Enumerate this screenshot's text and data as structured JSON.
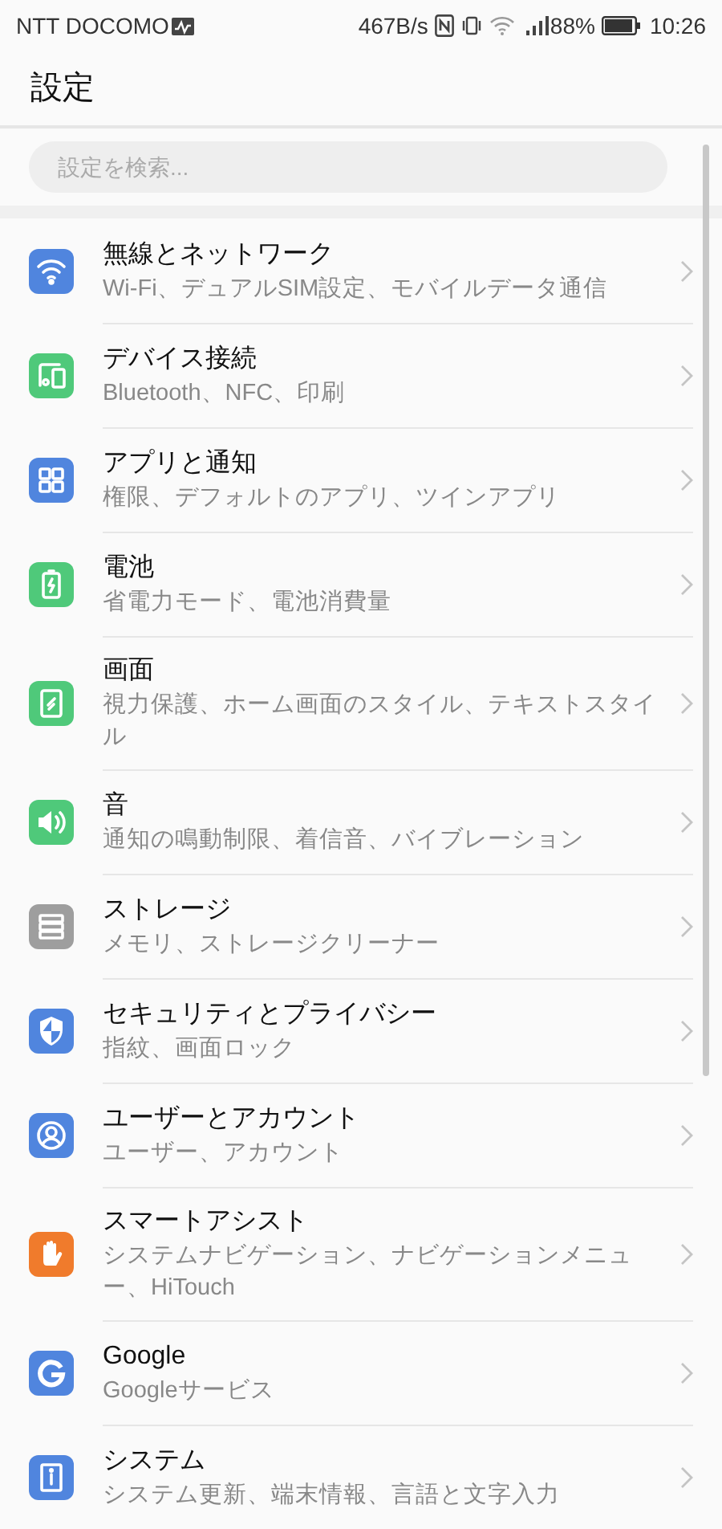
{
  "status_bar": {
    "carrier": "NTT DOCOMO",
    "speed": "467B/s",
    "battery": "88%",
    "time": "10:26"
  },
  "header": {
    "title": "設定"
  },
  "search": {
    "placeholder": "設定を検索..."
  },
  "items": [
    {
      "color": "#5085de",
      "title": "無線とネットワーク",
      "subtitle": "Wi-Fi、デュアルSIM設定、モバイルデータ通信"
    },
    {
      "color": "#4fc97a",
      "title": "デバイス接続",
      "subtitle": "Bluetooth、NFC、印刷"
    },
    {
      "color": "#5085de",
      "title": "アプリと通知",
      "subtitle": "権限、デフォルトのアプリ、ツインアプリ"
    },
    {
      "color": "#4fc97a",
      "title": "電池",
      "subtitle": "省電力モード、電池消費量"
    },
    {
      "color": "#4fc97a",
      "title": "画面",
      "subtitle": "視力保護、ホーム画面のスタイル、テキストスタイル"
    },
    {
      "color": "#4fc97a",
      "title": "音",
      "subtitle": "通知の鳴動制限、着信音、バイブレーション"
    },
    {
      "color": "#9e9e9e",
      "title": "ストレージ",
      "subtitle": "メモリ、ストレージクリーナー"
    },
    {
      "color": "#5085de",
      "title": "セキュリティとプライバシー",
      "subtitle": "指紋、画面ロック"
    },
    {
      "color": "#5085de",
      "title": "ユーザーとアカウント",
      "subtitle": "ユーザー、アカウント"
    },
    {
      "color": "#f07b2c",
      "title": "スマートアシスト",
      "subtitle": "システムナビゲーション、ナビゲーションメニュー、HiTouch"
    },
    {
      "color": "#5085de",
      "title": "Google",
      "subtitle": "Googleサービス"
    },
    {
      "color": "#5085de",
      "title": "システム",
      "subtitle": "システム更新、端末情報、言語と文字入力"
    }
  ]
}
